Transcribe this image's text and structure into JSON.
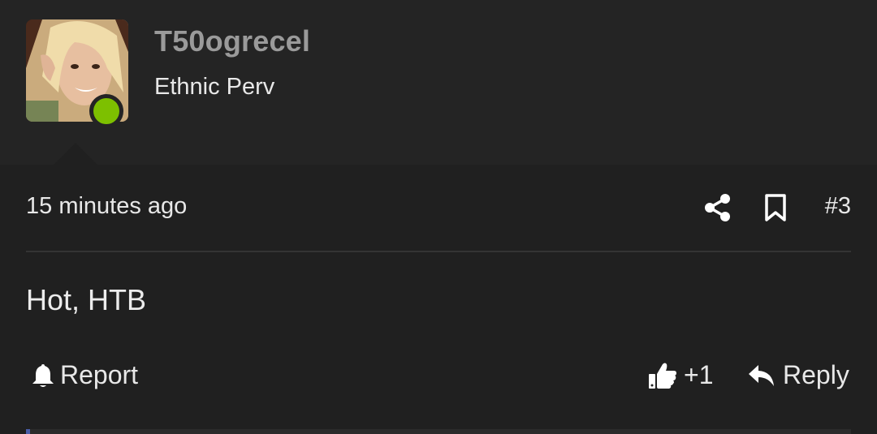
{
  "post": {
    "username": "T50ogrecel",
    "user_title": "Ethnic Perv",
    "timestamp": "15 minutes ago",
    "post_number": "#3",
    "body": "Hot, HTB",
    "like_count": "+1"
  },
  "actions": {
    "report_label": "Report",
    "reply_label": "Reply"
  },
  "icons": {
    "share": "share-icon",
    "bookmark": "bookmark-icon",
    "report": "bell-icon",
    "like": "thumbs-up-icon",
    "reply": "reply-arrow-icon"
  },
  "colors": {
    "background": "#202020",
    "header_background": "#242424",
    "online_indicator": "#7dc000",
    "username": "#9a9a9a",
    "text": "#e8e8e8"
  }
}
